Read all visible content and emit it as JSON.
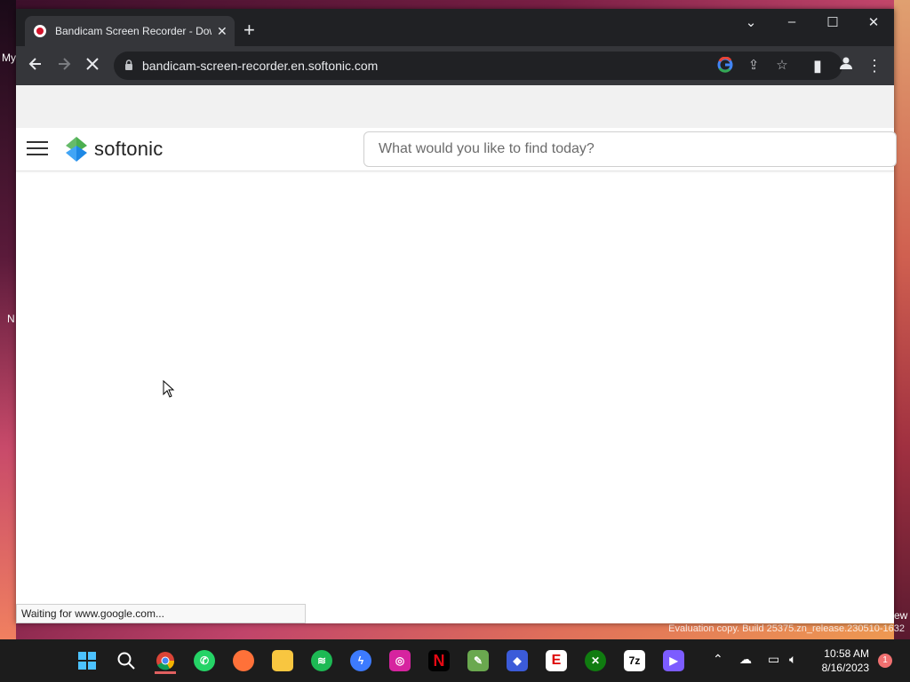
{
  "browser": {
    "tab": {
      "title": "Bandicam Screen Recorder - Dow"
    },
    "url": "bandicam-screen-recorder.en.softonic.com",
    "status_text": "Waiting for www.google.com..."
  },
  "site": {
    "logo_text": "softonic",
    "search_placeholder": "What would you like to find today?"
  },
  "desktop": {
    "label_top": "My",
    "label_mid": "N",
    "label_right": "ew",
    "watermark": "Evaluation copy. Build 25375.zn_release.230510-1632"
  },
  "taskbar": {
    "time": "10:58 AM",
    "date": "8/16/2023",
    "notification_count": "1",
    "apps": [
      "start",
      "search",
      "chrome",
      "whatsapp",
      "firefox",
      "file-explorer",
      "spotify",
      "messenger",
      "instagram",
      "netflix",
      "notepad",
      "copilot",
      "espn",
      "xbox",
      "7zip",
      "clipchamp"
    ]
  },
  "colors": {
    "chrome_dark": "#202124",
    "chrome_toolbar": "#35363a",
    "softonic_green": "#4caf50",
    "softonic_blue": "#1e88e5"
  }
}
